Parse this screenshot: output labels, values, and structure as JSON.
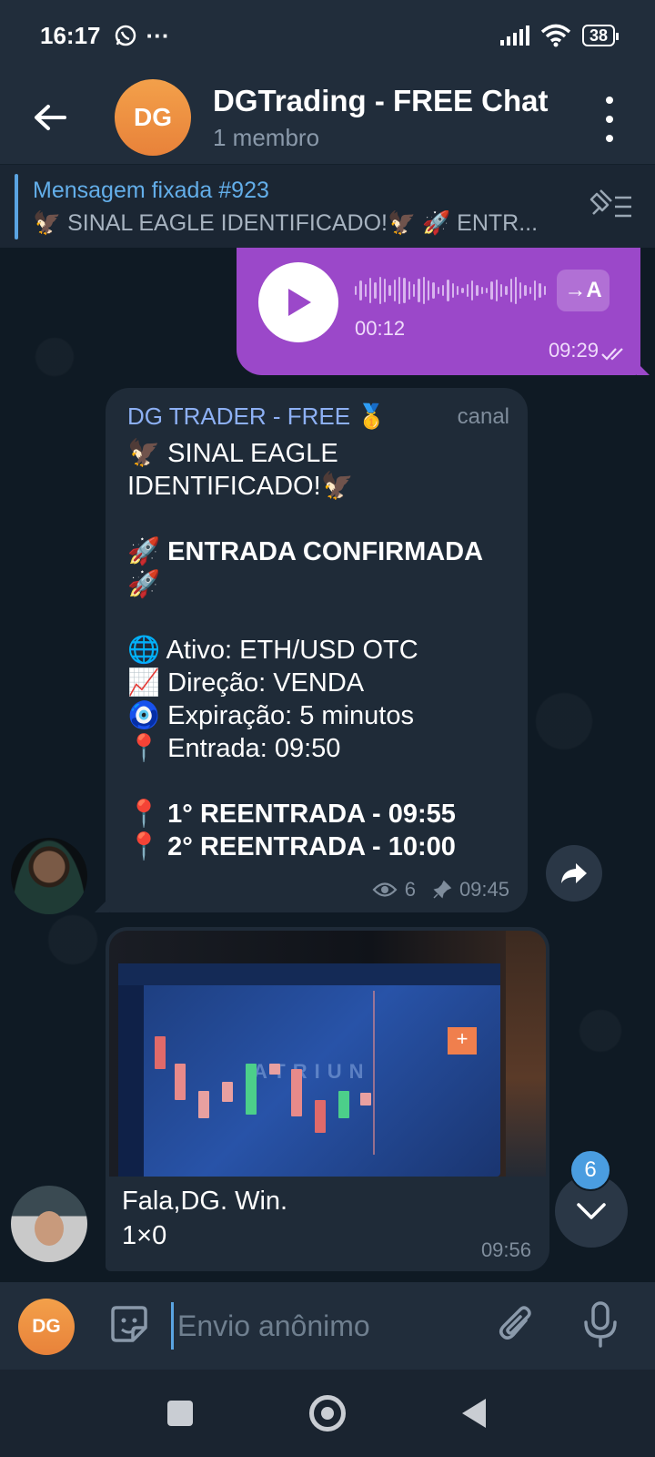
{
  "status_bar": {
    "time": "16:17",
    "more": "···",
    "battery": "38",
    "icons": [
      "whatsapp-icon",
      "signal-icon",
      "wifi-icon",
      "battery-icon"
    ]
  },
  "header": {
    "avatar_initials": "DG",
    "title": "DGTrading - FREE Chat",
    "subtitle": "1 membro",
    "avatar_color": "#F0933F"
  },
  "pinned": {
    "title": "Mensagem fixada #923",
    "preview": "🦅 SINAL EAGLE IDENTIFICADO!🦅  🚀 ENTR..."
  },
  "voice_message": {
    "duration": "00:12",
    "transcribe_label": "→A",
    "time": "09:29",
    "bubble_color": "#9B48C9"
  },
  "channel_message": {
    "sender": "DG TRADER - FREE 🥇",
    "tag": "canal",
    "lines": [
      "🦅 SINAL EAGLE IDENTIFICADO!🦅",
      "",
      "🚀 ENTRADA CONFIRMADA 🚀",
      "",
      "🌐 Ativo: ETH/USD OTC",
      "📈 Direção: VENDA",
      "🧿 Expiração: 5 minutos",
      "📍 Entrada:  09:50",
      "",
      "📍 1° REENTRADA -  09:55",
      "📍 2° REENTRADA - 10:00"
    ],
    "views": "6",
    "time": "09:45"
  },
  "photo_message": {
    "caption_line1": "Fala,DG. Win.",
    "caption_line2": "1×0",
    "time": "09:56",
    "screen_brand": "ATRIUN"
  },
  "scroll": {
    "unread_count": "6"
  },
  "input": {
    "avatar_initials": "DG",
    "placeholder": "Envio anônimo"
  }
}
